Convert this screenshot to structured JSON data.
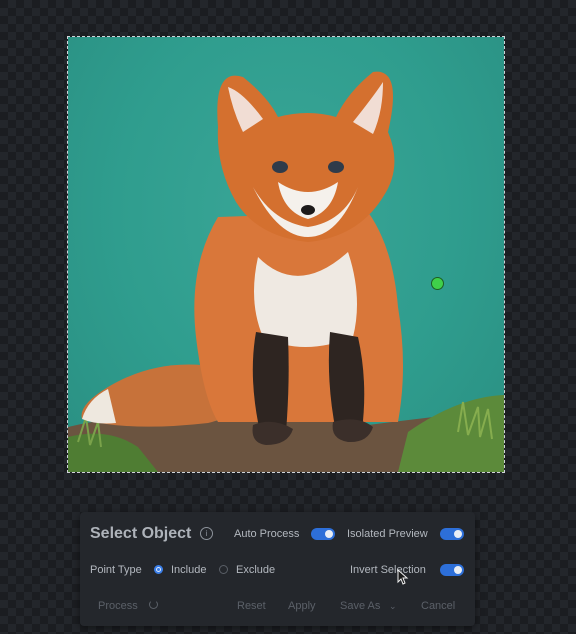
{
  "panel": {
    "title": "Select Object",
    "auto_process_label": "Auto Process",
    "auto_process_on": true,
    "isolated_preview_label": "Isolated Preview",
    "isolated_preview_on": true,
    "point_type_label": "Point Type",
    "include_label": "Include",
    "exclude_label": "Exclude",
    "point_type_selected": "Include",
    "invert_selection_label": "Invert Selection",
    "invert_selection_on": true
  },
  "actions": {
    "process_label": "Process",
    "reset_label": "Reset",
    "apply_label": "Apply",
    "save_as_label": "Save As",
    "cancel_label": "Cancel"
  },
  "colors": {
    "accent": "#2d6fd9",
    "point_include": "#3fd04a",
    "canvas_bg": "#2f9d8e"
  },
  "icons": [
    "info-icon",
    "chevron-down-icon",
    "spinner-icon",
    "cursor-icon"
  ]
}
